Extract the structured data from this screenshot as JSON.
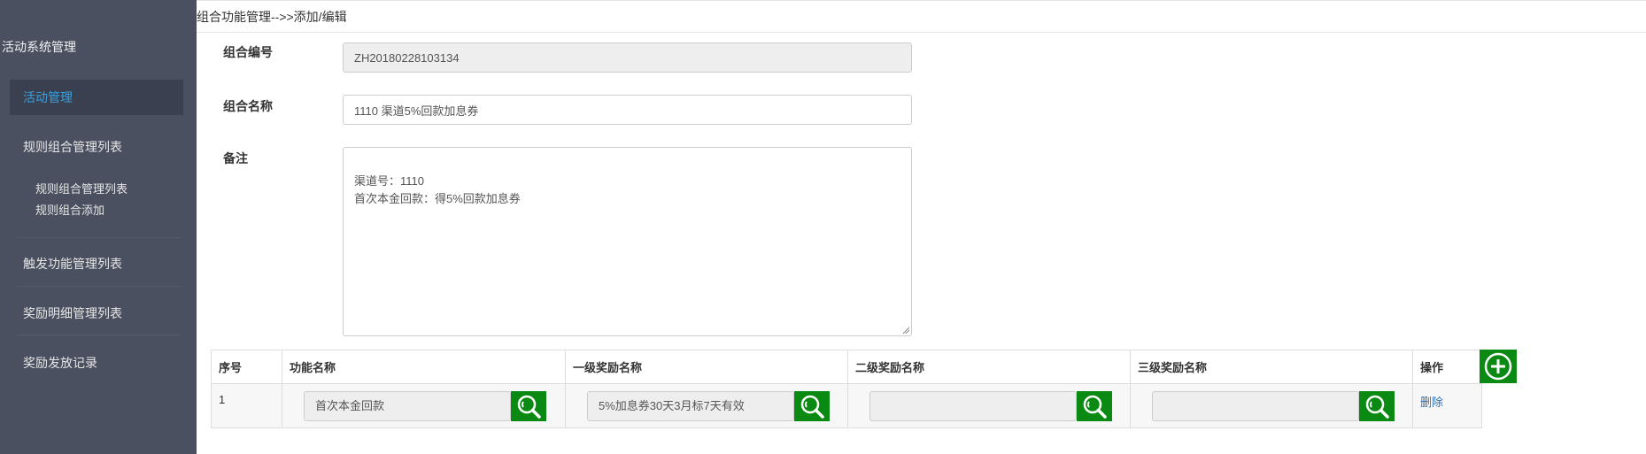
{
  "sidebar": {
    "system_title": "活动系统管理",
    "active_item": "活动管理",
    "items": [
      {
        "label": "规则组合管理列表"
      },
      {
        "label": "触发功能管理列表"
      },
      {
        "label": "奖励明细管理列表"
      },
      {
        "label": "奖励发放记录"
      }
    ],
    "sub_items": [
      {
        "label": "规则组合管理列表"
      },
      {
        "label": "规则组合添加"
      }
    ],
    "colors": {
      "background": "#4a5060",
      "active_bg": "#3a404f",
      "active_text": "#3aa0e0"
    }
  },
  "breadcrumb": "组合功能管理-->>添加/编辑",
  "form": {
    "code_label": "组合编号",
    "code_value": "ZH20180228103134",
    "name_label": "组合名称",
    "name_value": "1110 渠道5%回款加息券",
    "note_label": "备注",
    "note_value": "渠道号：1110\n首次本金回款：得5%回款加息券"
  },
  "table": {
    "headers": [
      "序号",
      "功能名称",
      "一级奖励名称",
      "二级奖励名称",
      "三级奖励名称",
      "操作"
    ],
    "rows": [
      {
        "index": "1",
        "function_name": "首次本金回款",
        "reward_level1": "5%加息券30天3月标7天有效",
        "reward_level2": "",
        "reward_level3": "",
        "action": "删除"
      }
    ]
  },
  "icons": {
    "search": "search-icon",
    "add": "plus-circle-icon"
  },
  "accent_color": "#0a8a12"
}
